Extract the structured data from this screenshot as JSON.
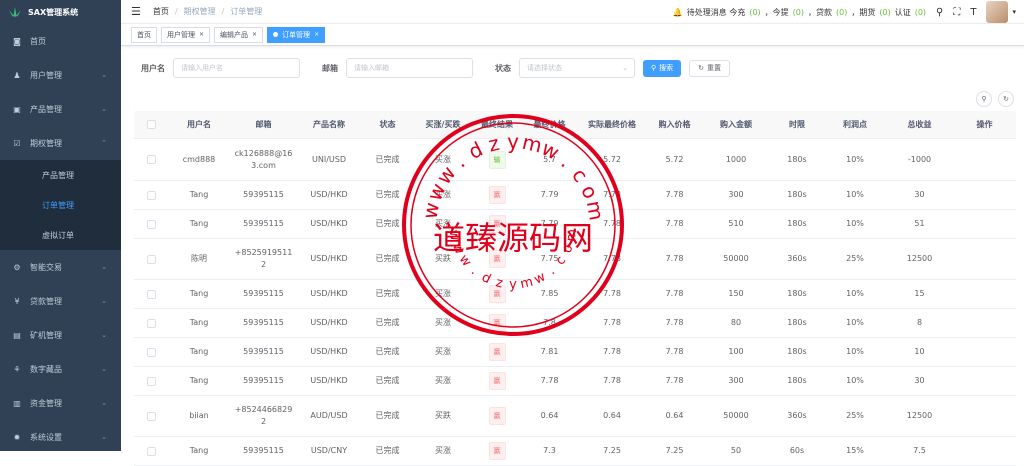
{
  "app": {
    "title": "SAX管理系统"
  },
  "sidebar": {
    "items": [
      {
        "label": "首页",
        "icon": "dashboard-icon",
        "has_children": false
      },
      {
        "label": "用户管理",
        "icon": "user-icon",
        "has_children": true
      },
      {
        "label": "产品管理",
        "icon": "shop-icon",
        "has_children": true
      },
      {
        "label": "期权管理",
        "icon": "document-icon",
        "has_children": true
      }
    ],
    "submenu": [
      "产品管理",
      "订单管理",
      "虚拟订单"
    ],
    "submenu_active": 1,
    "items_after": [
      {
        "label": "智能交易",
        "icon": "gear-icon"
      },
      {
        "label": "贷款管理",
        "icon": "money-icon"
      },
      {
        "label": "矿机管理",
        "icon": "server-icon"
      },
      {
        "label": "数字藏品",
        "icon": "collection-icon"
      },
      {
        "label": "资金管理",
        "icon": "wallet-icon"
      },
      {
        "label": "系统设置",
        "icon": "settings-icon"
      }
    ]
  },
  "breadcrumb": [
    "首页",
    "期权管理",
    "订单管理"
  ],
  "header": {
    "notice_label": "待处理消息 今充",
    "recharge_count": "(0)",
    "withdraw_label": "，今提",
    "withdraw_count": "(0)",
    "loan_label": "，贷款",
    "loan_count": "(0)",
    "futures_label": "，期货",
    "futures_count": "(0)",
    "verify_label": "认证",
    "verify_count": "(0)"
  },
  "tags": [
    {
      "label": "首页",
      "active": false,
      "closable": false
    },
    {
      "label": "用户管理",
      "active": false,
      "closable": true
    },
    {
      "label": "编辑产品",
      "active": false,
      "closable": true
    },
    {
      "label": "订单管理",
      "active": true,
      "closable": true
    }
  ],
  "filters": {
    "username_label": "用户名",
    "username_placeholder": "请输入用户名",
    "email_label": "邮箱",
    "email_placeholder": "请输入邮箱",
    "status_label": "状态",
    "status_placeholder": "请选择状态",
    "search_label": "搜索",
    "reset_label": "重置"
  },
  "table": {
    "columns": [
      "用户名",
      "邮箱",
      "产品名称",
      "状态",
      "买涨/买跌",
      "最终结果",
      "最终价格",
      "实际最终价格",
      "购入价格",
      "购入金额",
      "时限",
      "利润点",
      "总收益",
      "操作"
    ],
    "rows": [
      {
        "user": "cmd888",
        "email": "ck126888@163.com",
        "product": "UNI/USD",
        "status": "已完成",
        "direction": "买涨",
        "result": "输",
        "final": "5.7",
        "actual": "5.72",
        "buy": "5.72",
        "amount": "1000",
        "period": "180s",
        "profit": "10%",
        "total": "-1000"
      },
      {
        "user": "Tang",
        "email": "59395115",
        "product": "USD/HKD",
        "status": "已完成",
        "direction": "买涨",
        "result": "赢",
        "final": "7.79",
        "actual": "7.78",
        "buy": "7.78",
        "amount": "300",
        "period": "180s",
        "profit": "10%",
        "total": "30"
      },
      {
        "user": "Tang",
        "email": "59395115",
        "product": "USD/HKD",
        "status": "已完成",
        "direction": "买涨",
        "result": "赢",
        "final": "7.79",
        "actual": "7.78",
        "buy": "7.78",
        "amount": "510",
        "period": "180s",
        "profit": "10%",
        "total": "51"
      },
      {
        "user": "陈明",
        "email": "+8525919511 2",
        "product": "USD/HKD",
        "status": "已完成",
        "direction": "买跌",
        "result": "赢",
        "final": "7.75",
        "actual": "7.78",
        "buy": "7.78",
        "amount": "50000",
        "period": "360s",
        "profit": "25%",
        "total": "12500"
      },
      {
        "user": "Tang",
        "email": "59395115",
        "product": "USD/HKD",
        "status": "已完成",
        "direction": "买涨",
        "result": "赢",
        "final": "7.85",
        "actual": "7.78",
        "buy": "7.78",
        "amount": "150",
        "period": "180s",
        "profit": "10%",
        "total": "15"
      },
      {
        "user": "Tang",
        "email": "59395115",
        "product": "USD/HKD",
        "status": "已完成",
        "direction": "买涨",
        "result": "赢",
        "final": "7.8",
        "actual": "7.78",
        "buy": "7.78",
        "amount": "80",
        "period": "180s",
        "profit": "10%",
        "total": "8"
      },
      {
        "user": "Tang",
        "email": "59395115",
        "product": "USD/HKD",
        "status": "已完成",
        "direction": "买涨",
        "result": "赢",
        "final": "7.81",
        "actual": "7.78",
        "buy": "7.78",
        "amount": "100",
        "period": "180s",
        "profit": "10%",
        "total": "10"
      },
      {
        "user": "Tang",
        "email": "59395115",
        "product": "USD/HKD",
        "status": "已完成",
        "direction": "买涨",
        "result": "赢",
        "final": "7.78",
        "actual": "7.78",
        "buy": "7.78",
        "amount": "300",
        "period": "180s",
        "profit": "10%",
        "total": "30"
      },
      {
        "user": "biian",
        "email": "+8524466829 2",
        "product": "AUD/USD",
        "status": "已完成",
        "direction": "买跌",
        "result": "赢",
        "final": "0.64",
        "actual": "0.64",
        "buy": "0.64",
        "amount": "50000",
        "period": "360s",
        "profit": "25%",
        "total": "12500"
      },
      {
        "user": "Tang",
        "email": "59395115",
        "product": "USD/CNY",
        "status": "已完成",
        "direction": "买涨",
        "result": "赢",
        "final": "7.3",
        "actual": "7.25",
        "buy": "7.25",
        "amount": "50",
        "period": "60s",
        "profit": "15%",
        "total": "7.5"
      }
    ]
  },
  "watermark": {
    "text": "道臻源码网",
    "url": "www.dzymw.com",
    "color": "#e0001b"
  }
}
